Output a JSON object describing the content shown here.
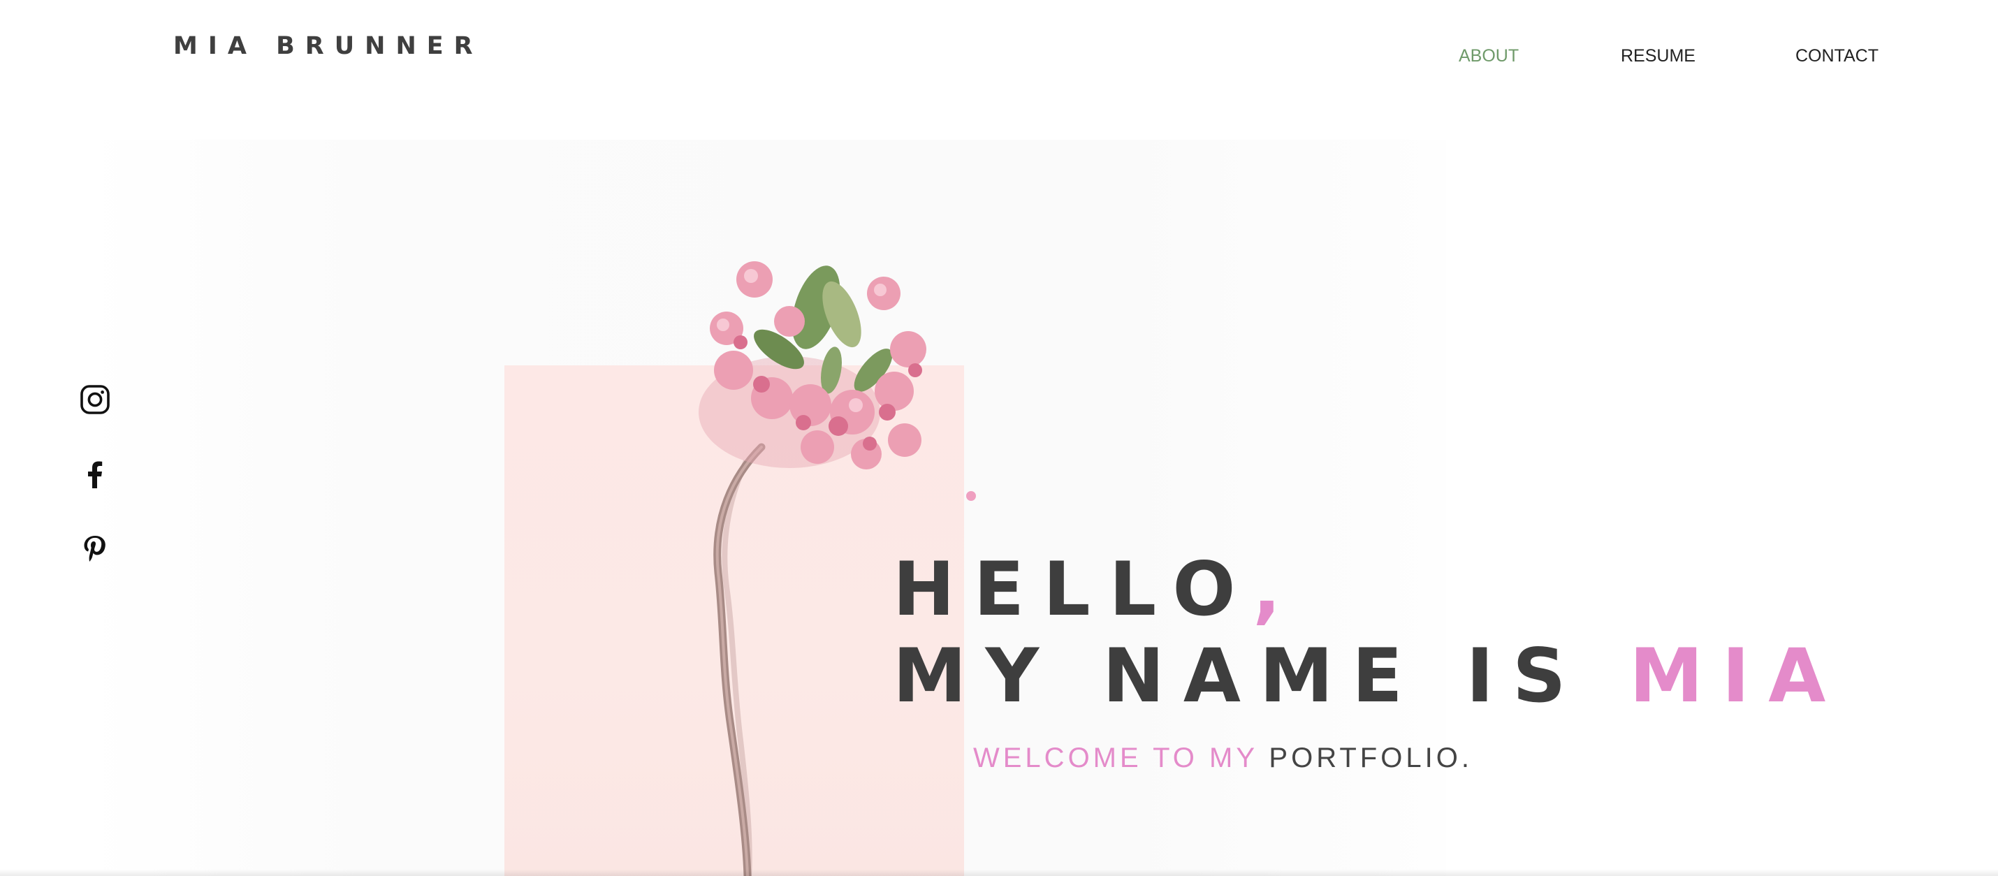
{
  "header": {
    "brand": "MIA BRUNNER"
  },
  "nav": {
    "items": [
      {
        "label": "ABOUT",
        "active": true
      },
      {
        "label": "RESUME",
        "active": false
      },
      {
        "label": "CONTACT",
        "active": false
      }
    ]
  },
  "social": {
    "icons": [
      "instagram-icon",
      "facebook-icon",
      "pinterest-icon"
    ]
  },
  "hero": {
    "line1": "HELLO",
    "line1_comma": ",",
    "line2_lead": "MY NAME IS ",
    "line2_name": "MIA",
    "tagline_accent": "WELCOME TO MY",
    "tagline_rest": " PORTFOLIO."
  },
  "colors": {
    "accent_pink": "#e48bca",
    "nav_active_green": "#6f9a6a",
    "text_dark": "#3e3e3e",
    "block_pink": "#fde8e6"
  }
}
